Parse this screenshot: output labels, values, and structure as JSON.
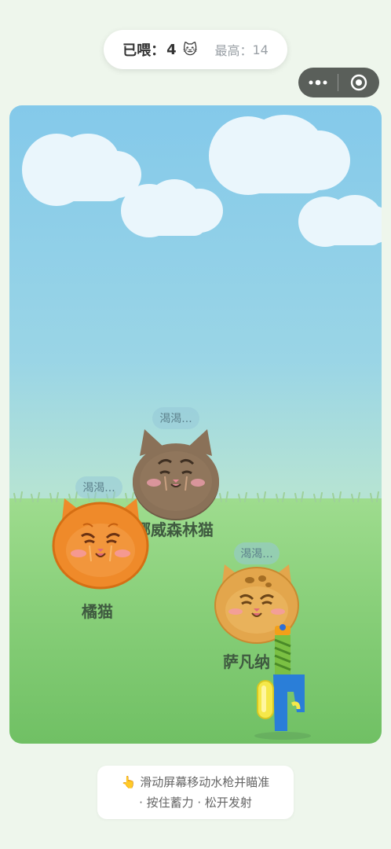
{
  "score": {
    "fed_label": "已喂：",
    "fed_value": "4",
    "fed_icon": "cat-face-icon",
    "best_label": "最高：",
    "best_value": "14"
  },
  "capsule": {
    "more_icon": "more-dots-icon",
    "close_icon": "target-circle-icon"
  },
  "cats": [
    {
      "name": "挪威森林猫",
      "bubble": "渴渴...",
      "color": "#8a7158"
    },
    {
      "name": "橘猫",
      "bubble": "渴渴...",
      "color": "#ef8a2a"
    },
    {
      "name": "萨凡纳",
      "bubble": "渴渴...",
      "color": "#e3a64c"
    }
  ],
  "water_gun": {
    "icon": "water-gun-icon"
  },
  "hint": {
    "line1": "👆 滑动屏幕移动水枪并瞄准",
    "line2": "· 按住蓄力 · 松开发射"
  }
}
